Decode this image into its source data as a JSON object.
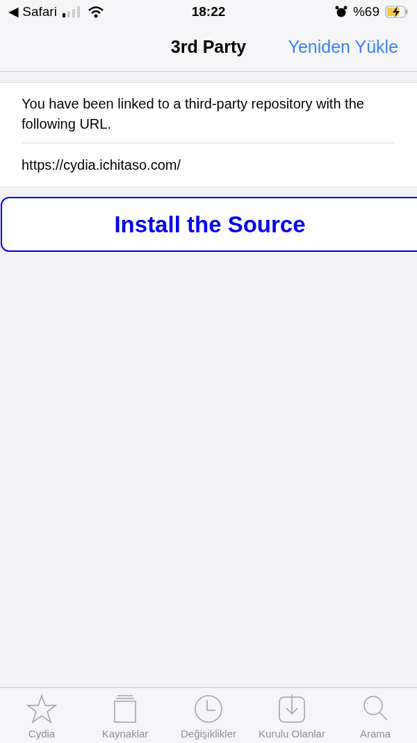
{
  "status_bar": {
    "back_app": "◀ Safari",
    "time": "18:22",
    "battery": "%69"
  },
  "nav_bar": {
    "title": "3rd Party",
    "action": "Yeniden Yükle"
  },
  "message": "You have been linked to a third-party repository with the following URL.",
  "url": "https://cydia.ichitaso.com/",
  "install_button": "Install the Source",
  "tab_bar": [
    {
      "label": "Cydia",
      "kind": "star",
      "selected": false
    },
    {
      "label": "Kaynaklar",
      "kind": "sources",
      "selected": false
    },
    {
      "label": "Değişiklikler",
      "kind": "clock",
      "selected": false
    },
    {
      "label": "Kurulu Olanlar",
      "kind": "download",
      "selected": false
    },
    {
      "label": "Arama",
      "kind": "search",
      "selected": false
    }
  ]
}
